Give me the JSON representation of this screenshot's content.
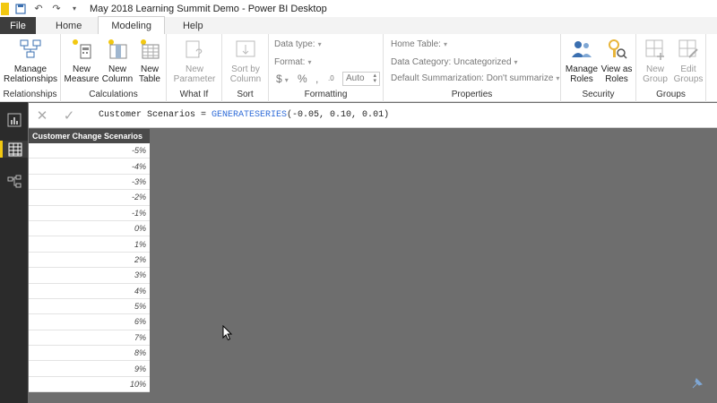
{
  "window": {
    "title": "May 2018 Learning Summit Demo - Power BI Desktop"
  },
  "tabs": {
    "file": "File",
    "items": [
      "Home",
      "Modeling",
      "Help"
    ],
    "active": "Modeling"
  },
  "ribbon": {
    "relationships": {
      "button": [
        "Manage",
        "Relationships"
      ],
      "label": "Relationships"
    },
    "calculations": {
      "buttons": [
        [
          "New",
          "Measure"
        ],
        [
          "New",
          "Column"
        ],
        [
          "New",
          "Table"
        ]
      ],
      "label": "Calculations"
    },
    "whatif": {
      "button": [
        "New",
        "Parameter"
      ],
      "label": "What If"
    },
    "sort": {
      "button": [
        "Sort by",
        "Column"
      ],
      "label": "Sort"
    },
    "formatting": {
      "data_type": "Data type:",
      "format": "Format:",
      "currency": "$",
      "percent": "%",
      "comma": ",",
      "decimals": ".0",
      "auto": "Auto",
      "label": "Formatting"
    },
    "properties": {
      "home_table": "Home Table:",
      "data_category": "Data Category: Uncategorized",
      "summarization": "Default Summarization: Don't summarize",
      "label": "Properties"
    },
    "security": {
      "buttons": [
        [
          "Manage",
          "Roles"
        ],
        [
          "View as",
          "Roles"
        ]
      ],
      "label": "Security"
    },
    "groups": {
      "buttons": [
        [
          "New",
          "Group"
        ],
        [
          "Edit",
          "Groups"
        ]
      ],
      "label": "Groups"
    }
  },
  "formula": {
    "prefix": "Customer Scenarios = ",
    "function": "GENERATESERIES",
    "args": "(-0.05, 0.10, 0.01)"
  },
  "table": {
    "header": "Customer Change Scenarios",
    "rows": [
      "-5%",
      "-4%",
      "-3%",
      "-2%",
      "-1%",
      "0%",
      "1%",
      "2%",
      "3%",
      "4%",
      "5%",
      "6%",
      "7%",
      "8%",
      "9%",
      "10%"
    ]
  },
  "colors": {
    "accent": "#f2c811",
    "function": "#2e6bd8",
    "canvas": "#6e6e6e",
    "nav": "#2b2b2b"
  }
}
